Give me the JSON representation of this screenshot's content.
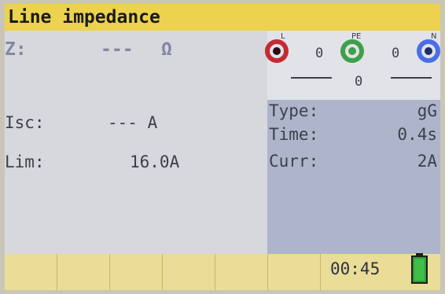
{
  "title": "Line impedance",
  "z": {
    "label": "Z:",
    "value": "---",
    "unit": "Ω"
  },
  "isc": {
    "label": "Isc:",
    "value": "--- A"
  },
  "lim": {
    "label": "Lim:",
    "value": "16.0A"
  },
  "terminals": {
    "l_label": "L",
    "pe_label": "PE",
    "n_label": "N",
    "l_pe_value": "0",
    "pe_n_value": "0",
    "l_n_value": "0"
  },
  "params": {
    "type_label": "Type:",
    "type_value": "gG",
    "time_label": "Time:",
    "time_value": "0.4s",
    "curr_label": "Curr:",
    "curr_value": "2A"
  },
  "status": {
    "timer": "00:45",
    "battery_icon": "battery-full-icon",
    "battery_color": "#3fbf49"
  },
  "colors": {
    "title_bar": "#ecd24e",
    "terminal_l": "#c42a32",
    "terminal_pe": "#3ea04a",
    "terminal_n": "#4a6ee8"
  }
}
